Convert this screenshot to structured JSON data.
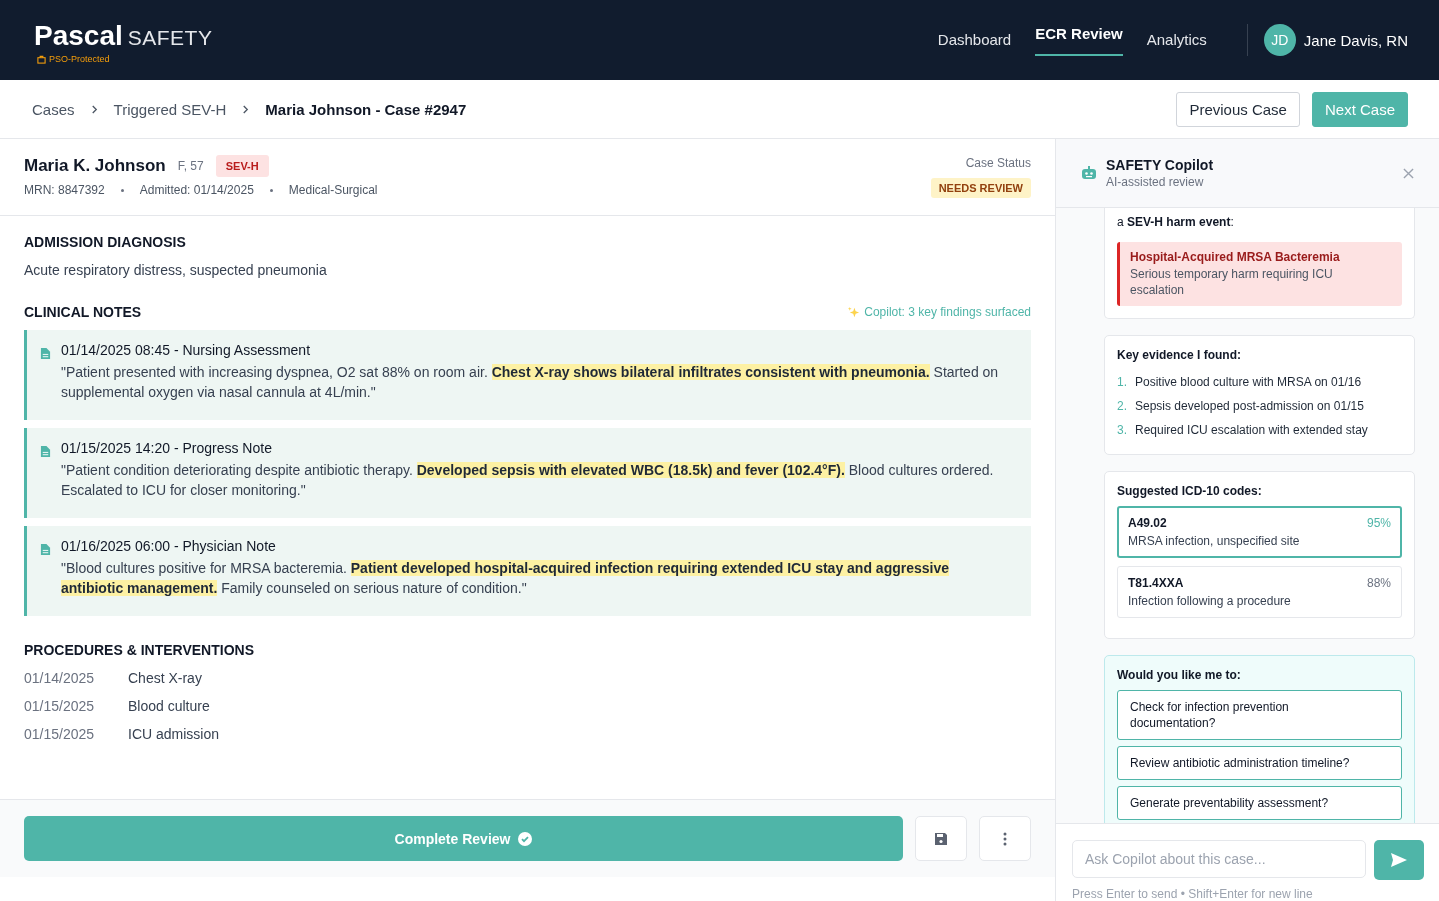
{
  "brand": {
    "name": "Pascal",
    "product": "SAFETY",
    "badge": "PSO-Protected"
  },
  "nav": [
    {
      "label": "Dashboard",
      "selected": false
    },
    {
      "label": "ECR Review",
      "selected": true
    },
    {
      "label": "Analytics",
      "selected": false
    }
  ],
  "user": {
    "initials": "JD",
    "name": "Jane Davis, RN"
  },
  "breadcrumb": [
    "Cases",
    "Triggered SEV-H",
    "Maria Johnson - Case #2947"
  ],
  "case_nav": {
    "previous": "Previous Case",
    "next": "Next Case"
  },
  "patient": {
    "name": "Maria K. Johnson",
    "sex_age": "F, 57",
    "severity": "SEV-H",
    "mrn": "MRN: 8847392",
    "admitted": "Admitted: 01/14/2025",
    "unit": "Medical-Surgical",
    "status_label": "Case Status",
    "status": "NEEDS REVIEW"
  },
  "diagnosis": {
    "title": "ADMISSION DIAGNOSIS",
    "text": "Acute respiratory distress, suspected pneumonia"
  },
  "clinical_notes": {
    "title": "CLINICAL NOTES",
    "copilot_hint": "Copilot: 3 key findings surfaced",
    "notes": [
      {
        "title": "01/14/2025 08:45 - Nursing Assessment",
        "text": "\"Patient presented with increasing dyspnea, O2 sat 88% on room air. **Chest X-ray shows bilateral infiltrates consistent with pneumonia.** Started on supplemental oxygen via nasal cannula at 4L/min.\""
      },
      {
        "title": "01/15/2025 14:20 - Progress Note",
        "text": "\"Patient condition deteriorating despite antibiotic therapy. **Developed sepsis with elevated WBC (18.5k) and fever (102.4°F).** Blood cultures ordered. Escalated to ICU for closer monitoring.\""
      },
      {
        "title": "01/16/2025 06:00 - Physician Note",
        "text": "\"Blood cultures positive for MRSA bacteremia. **Patient developed hospital-acquired infection requiring extended ICU stay and aggressive antibiotic management.** Family counseled on serious nature of condition.\""
      }
    ]
  },
  "procedures": {
    "title": "PROCEDURES & INTERVENTIONS",
    "rows": [
      {
        "date": "01/14/2025",
        "name": "Chest X-ray"
      },
      {
        "date": "01/15/2025",
        "name": "Blood culture"
      },
      {
        "date": "01/15/2025",
        "name": "ICU admission"
      }
    ]
  },
  "actions": {
    "complete": "Complete Review"
  },
  "copilot": {
    "title": "SAFETY Copilot",
    "subtitle": "AI-assisted review",
    "intro": "a **SEV-H harm event**:",
    "alert": {
      "title": "Hospital-Acquired MRSA Bacteremia",
      "text": "Serious temporary harm requiring ICU escalation"
    },
    "evidence_title": "Key evidence I found:",
    "evidence": [
      {
        "num": "1.",
        "text": "Positive blood culture with MRSA on 01/16"
      },
      {
        "num": "2.",
        "text": "Sepsis developed post-admission on 01/15"
      },
      {
        "num": "3.",
        "text": "Required ICU escalation with extended stay"
      }
    ],
    "codes_title": "Suggested ICD-10 codes:",
    "codes": [
      {
        "code": "A49.02",
        "desc": "MRSA infection, unspecified site",
        "confidence": "95%",
        "selected": true
      },
      {
        "code": "T81.4XXA",
        "desc": "Infection following a procedure",
        "confidence": "88%",
        "selected": false
      }
    ],
    "suggest_title": "Would you like me to:",
    "suggestions": [
      "Check for infection prevention documentation?",
      "Review antibiotic administration timeline?",
      "Generate preventability assessment?"
    ],
    "input": {
      "placeholder": "Ask Copilot about this case..."
    },
    "hint": "Press Enter to send • Shift+Enter for new line"
  }
}
